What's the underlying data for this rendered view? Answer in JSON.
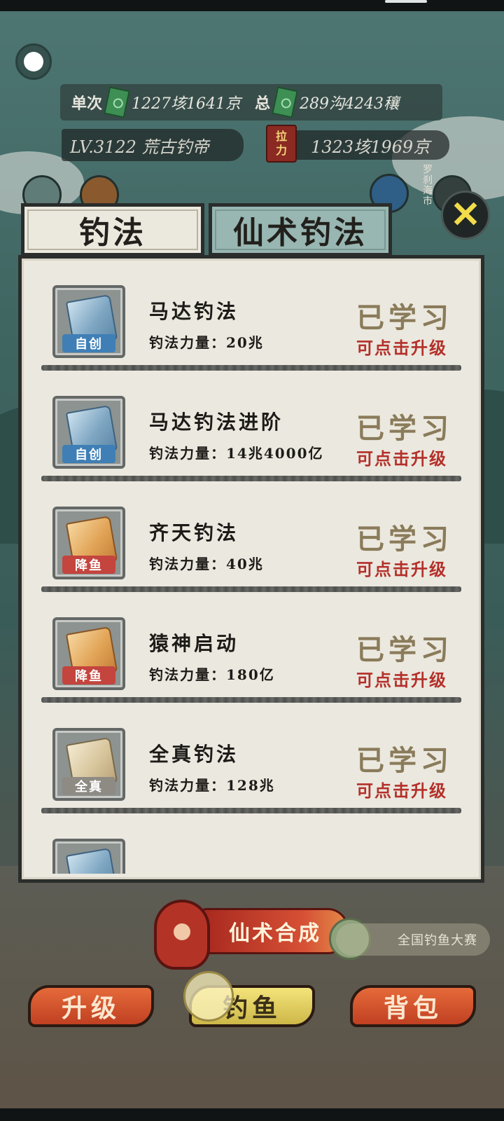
{
  "hud": {
    "single_label": "单次",
    "single_value": "1227垓1641京",
    "total_label": "总",
    "total_value": "289沟4243穰",
    "level_text": "LV.3122 荒古钓帝",
    "power_icon_top": "拉",
    "power_icon_bottom": "力",
    "power_value": "1323垓1969京",
    "side_label": "罗刹海市"
  },
  "tabs": {
    "fishing": "钓法",
    "immortal": "仙术钓法"
  },
  "close_glyph": "✕",
  "power_prefix": "钓法力量：",
  "items": [
    {
      "name": "马达钓法",
      "power": "钓法力量：20兆",
      "tag": "自创",
      "tag_style": "self",
      "book": "blue",
      "status": "已学习",
      "upgrade": "可点击升级"
    },
    {
      "name": "马达钓法进阶",
      "power": "钓法力量：14兆4000亿",
      "tag": "自创",
      "tag_style": "self",
      "book": "blue",
      "status": "已学习",
      "upgrade": "可点击升级"
    },
    {
      "name": "齐天钓法",
      "power": "钓法力量：40兆",
      "tag": "降鱼",
      "tag_style": "subdue",
      "book": "orange",
      "status": "已学习",
      "upgrade": "可点击升级"
    },
    {
      "name": "猿神启动",
      "power": "钓法力量：180亿",
      "tag": "降鱼",
      "tag_style": "subdue",
      "book": "orange",
      "status": "已学习",
      "upgrade": "可点击升级"
    },
    {
      "name": "全真钓法",
      "power": "钓法力量：128兆",
      "tag": "全真",
      "tag_style": "quanzhen",
      "book": "paper",
      "status": "已学习",
      "upgrade": "可点击升级"
    },
    {
      "name": "",
      "power": "",
      "tag": "",
      "tag_style": "self",
      "book": "blue",
      "status": "",
      "upgrade": ""
    }
  ],
  "bottom": {
    "synthesis": "仙术合成",
    "contest": "全国钓鱼大赛",
    "upgrade": "升级",
    "fish": "钓鱼",
    "bag": "背包"
  },
  "colors": {
    "status": "#8a7b5a",
    "upgrade": "#b4302a",
    "panel": "#ebe8df",
    "tab_active": "#ebe8de",
    "tab_inactive": "#98b6b2"
  }
}
